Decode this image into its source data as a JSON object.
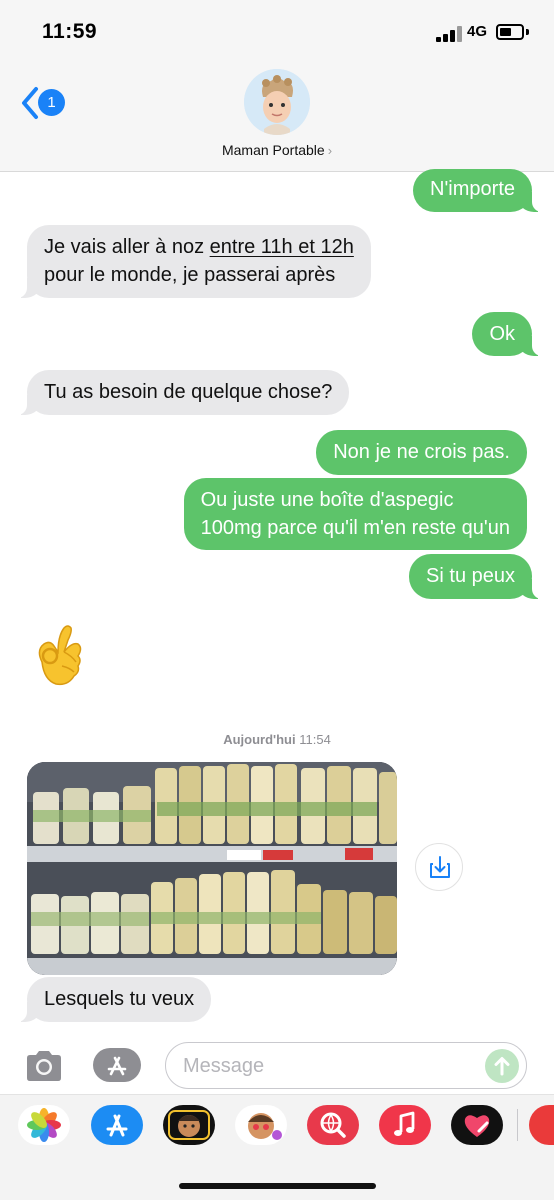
{
  "status_bar": {
    "time": "11:59",
    "network": "4G"
  },
  "header": {
    "back_badge_count": "1",
    "contact_name": "Maman Portable",
    "chevron": "›"
  },
  "messages": [
    {
      "direction": "outgoing",
      "text": "N'importe"
    },
    {
      "direction": "incoming",
      "line1_prefix": "Je vais aller à noz ",
      "line1_link": "entre 11h et 12h",
      "line2": "pour le monde, je passerai après"
    },
    {
      "direction": "outgoing",
      "text": "Ok"
    },
    {
      "direction": "incoming",
      "text": "Tu as besoin de quelque chose?"
    },
    {
      "direction": "outgoing",
      "text": "Non je ne crois pas."
    },
    {
      "direction": "outgoing",
      "line1": "Ou juste une boîte d'aspegic",
      "line2": "100mg parce qu'il m'en reste qu'un"
    },
    {
      "direction": "outgoing",
      "text": "Si tu peux"
    },
    {
      "direction": "incoming",
      "type": "emoji",
      "icon": "ok-hand-emoji"
    },
    {
      "direction": "incoming",
      "type": "photo",
      "subject": "supermarket shelves with jars of white asparagus"
    },
    {
      "direction": "incoming",
      "text": "Lesquels tu veux"
    }
  ],
  "timestamp": {
    "day": "Aujourd'hui",
    "time": "11:54"
  },
  "composer": {
    "placeholder": "Message",
    "value": ""
  },
  "icons": {
    "camera": "camera-icon",
    "apps": "app-store-icon",
    "send": "send-arrow-icon",
    "save": "save-download-icon"
  },
  "app_strip": [
    {
      "name": "photos-app-icon",
      "color": "#ffffff"
    },
    {
      "name": "app-store-app-icon",
      "color": "#1c8cf3"
    },
    {
      "name": "memoji-app-icon",
      "color": "#111111"
    },
    {
      "name": "memoji-stickers-app-icon",
      "color": "#ffffff"
    },
    {
      "name": "web-search-app-icon",
      "color": "#e8394b"
    },
    {
      "name": "music-app-icon",
      "color": "#f0364a"
    },
    {
      "name": "digital-touch-app-icon",
      "color": "#111111"
    },
    {
      "name": "more-app-icon",
      "color": "#ea3a3a"
    }
  ],
  "colors": {
    "outgoing_bubble": "#5dc46a",
    "incoming_bubble": "#e8e8ea",
    "accent_blue": "#1a82f7"
  }
}
